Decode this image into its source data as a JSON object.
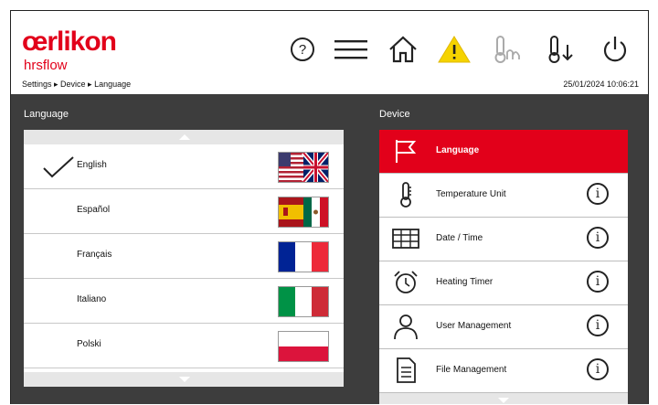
{
  "header": {
    "logo_main": "œrlikon",
    "logo_sub": "hrsflow",
    "breadcrumb": "Settings ▸ Device ▸ Language",
    "datetime": "25/01/2024 10:06:21",
    "icons": [
      "help-icon",
      "menu-icon",
      "home-icon",
      "warning-icon",
      "temperature-icon",
      "temperature-down-icon",
      "power-icon"
    ],
    "warning_color": "#f5d300"
  },
  "language_panel": {
    "title": "Language",
    "items": [
      {
        "label": "English",
        "selected": true,
        "flag": "gb-us"
      },
      {
        "label": "Español",
        "selected": false,
        "flag": "es-mx"
      },
      {
        "label": "Français",
        "selected": false,
        "flag": "fr"
      },
      {
        "label": "Italiano",
        "selected": false,
        "flag": "it"
      },
      {
        "label": "Polski",
        "selected": false,
        "flag": "pl"
      }
    ]
  },
  "device_panel": {
    "title": "Device",
    "items": [
      {
        "label": "Language",
        "icon": "flag-icon",
        "active": true
      },
      {
        "label": "Temperature Unit",
        "icon": "thermometer-icon",
        "active": false
      },
      {
        "label": "Date / Time",
        "icon": "calendar-icon",
        "active": false
      },
      {
        "label": "Heating Timer",
        "icon": "alarm-clock-icon",
        "active": false
      },
      {
        "label": "User Management",
        "icon": "user-icon",
        "active": false
      },
      {
        "label": "File Management",
        "icon": "file-icon",
        "active": false
      }
    ],
    "info_glyph": "i"
  },
  "colors": {
    "brand": "#e2001a",
    "background_dark": "#3d3d3d"
  }
}
